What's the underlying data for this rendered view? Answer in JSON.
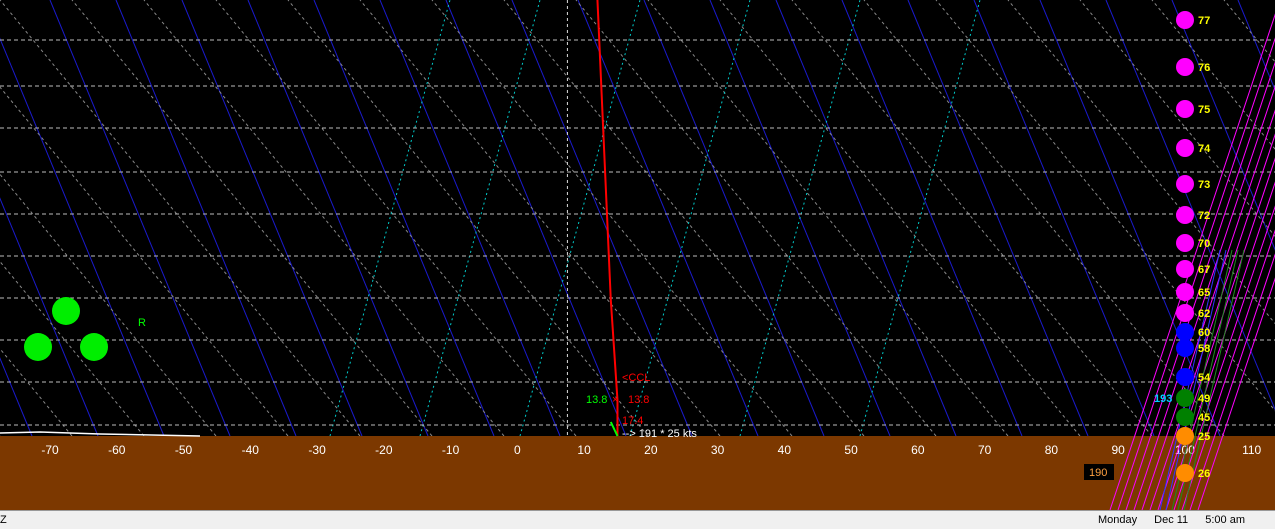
{
  "chart_data": {
    "type": "line",
    "title": "",
    "x_ticks": [
      -70,
      -60,
      -50,
      -40,
      -30,
      -20,
      -10,
      0,
      10,
      20,
      30,
      40,
      50,
      60,
      70,
      80,
      90,
      100,
      110
    ],
    "xlim": [
      -77.5,
      113.5
    ],
    "grid": true,
    "series": [
      {
        "values": [
          [
            12,
            0
          ],
          [
            13,
            150
          ],
          [
            14,
            300
          ],
          [
            15,
            400
          ],
          [
            15,
            436
          ]
        ]
      },
      {
        "values": [
          [
            14,
            422
          ],
          [
            15,
            436
          ]
        ]
      }
    ],
    "annotations": {
      "ccl": "<CCL",
      "dewpoint_value": "13.8",
      "temp_value": "13.8",
      "surface_value": "17.4",
      "wind": "--> 191 * 25 kts",
      "r_label": "R"
    },
    "right_scale_labels": [
      "77",
      "76",
      "75",
      "74",
      "73",
      "72",
      "70",
      "67",
      "65",
      "62",
      "60",
      "58",
      "54",
      "49",
      "45",
      "25",
      "26"
    ],
    "right_scale_colors": [
      "#ff00ff",
      "#ff00ff",
      "#ff00ff",
      "#ff00ff",
      "#ff00ff",
      "#ff00ff",
      "#ff00ff",
      "#ff00ff",
      "#ff00ff",
      "#ff00ff",
      "#0000ff",
      "#0000ff",
      "#0000ff",
      "#008000",
      "#008000",
      "#ff8c00",
      "#ff8c00"
    ],
    "right_tag": "193",
    "box_label": "190",
    "colors": {
      "background": "#000000",
      "ground": "#7c3800",
      "temperature": "#ff0000",
      "dewpoint": "#00ff00",
      "isotherms": "#1a1acc",
      "dry_adiabats": "#888888",
      "mixing_ratio": "#00cccc",
      "hodograph": "#ff00ff",
      "label_yellow": "#ffff00"
    }
  },
  "status": {
    "left": "Z",
    "day": "Monday",
    "date": "Dec 11",
    "time": "5:00 am"
  }
}
